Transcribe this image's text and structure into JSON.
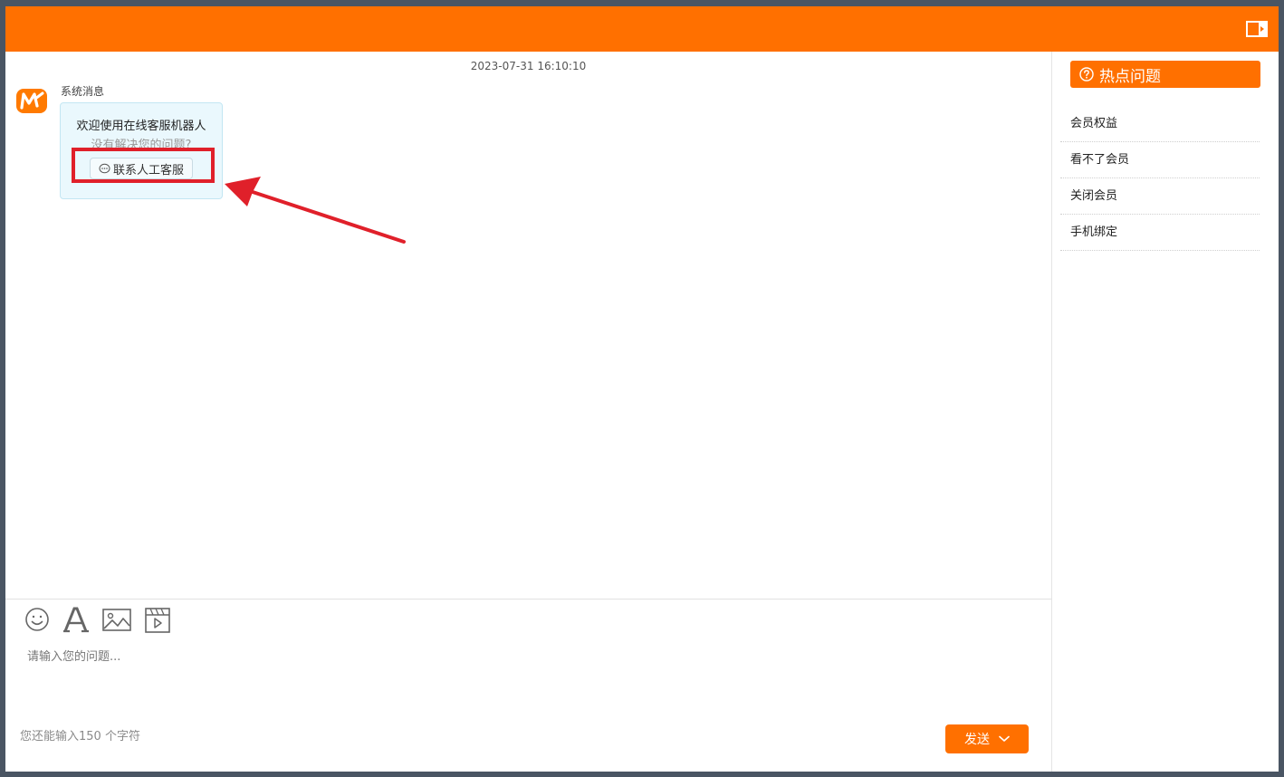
{
  "chat": {
    "timestamp": "2023-07-31 16:10:10",
    "sender": "系统消息",
    "message_title": "欢迎使用在线客服机器人",
    "message_sub": "没有解决您的问题?",
    "contact_button_label": "联系人工客服"
  },
  "composer": {
    "placeholder": "请输入您的问题...",
    "char_count": "您还能输入150 个字符",
    "send_label": "发送"
  },
  "sidebar": {
    "title": "热点问题",
    "items": [
      "会员权益",
      "看不了会员",
      "关闭会员",
      "手机绑定"
    ]
  },
  "colors": {
    "brand": "#ff7000",
    "highlight": "#e0202a",
    "bubble_bg": "#eaf8fd"
  },
  "icons": [
    "expand-panel-icon",
    "brand-logo-icon",
    "chat-bubble-icon",
    "emoji-icon",
    "font-icon",
    "image-icon",
    "video-icon",
    "chevron-down-icon",
    "question-circle-icon"
  ]
}
